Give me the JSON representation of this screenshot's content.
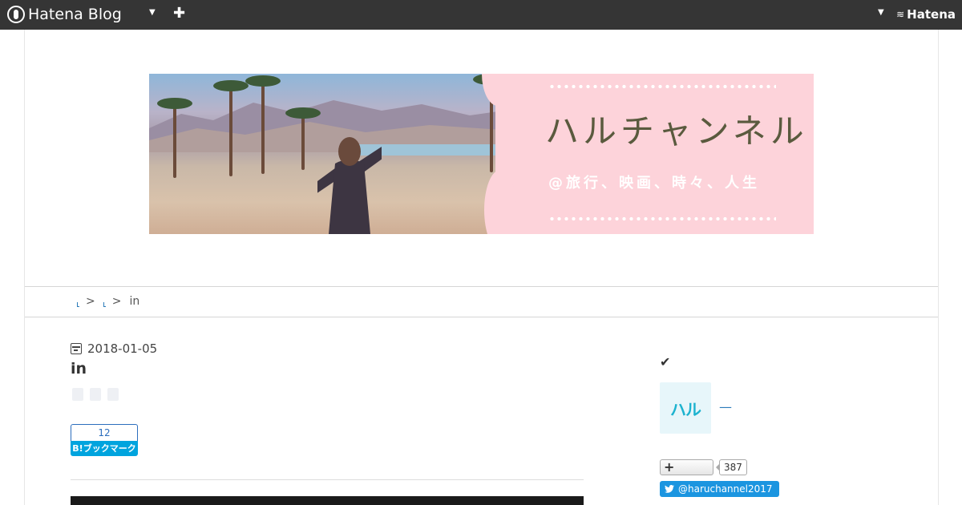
{
  "topbar": {
    "brand": "Hatena Blog",
    "add_icon": "plus-icon",
    "right_brand": "Hatena"
  },
  "banner": {
    "title": "ハルチャンネル",
    "tagline": "@旅行、映画、時々、人生"
  },
  "breadcrumb": {
    "separator": ">",
    "current": "in"
  },
  "entry": {
    "date": "2018-01-05",
    "title": "in"
  },
  "bookmark": {
    "count": "12",
    "label": "B!ブックマーク"
  },
  "sidebar": {
    "check_icon": "checkmark-icon",
    "avatar_text": "ハル",
    "author": "—",
    "subscribe_icon": "plus-icon",
    "subscriber_count": "387",
    "twitter_handle": "@haruchannel2017"
  },
  "colors": {
    "topbar": "#353535",
    "banner_pink": "#fdd3da",
    "link": "#2b7bb9",
    "hatebu": "#00a4de",
    "twitter": "#1b95e0"
  }
}
